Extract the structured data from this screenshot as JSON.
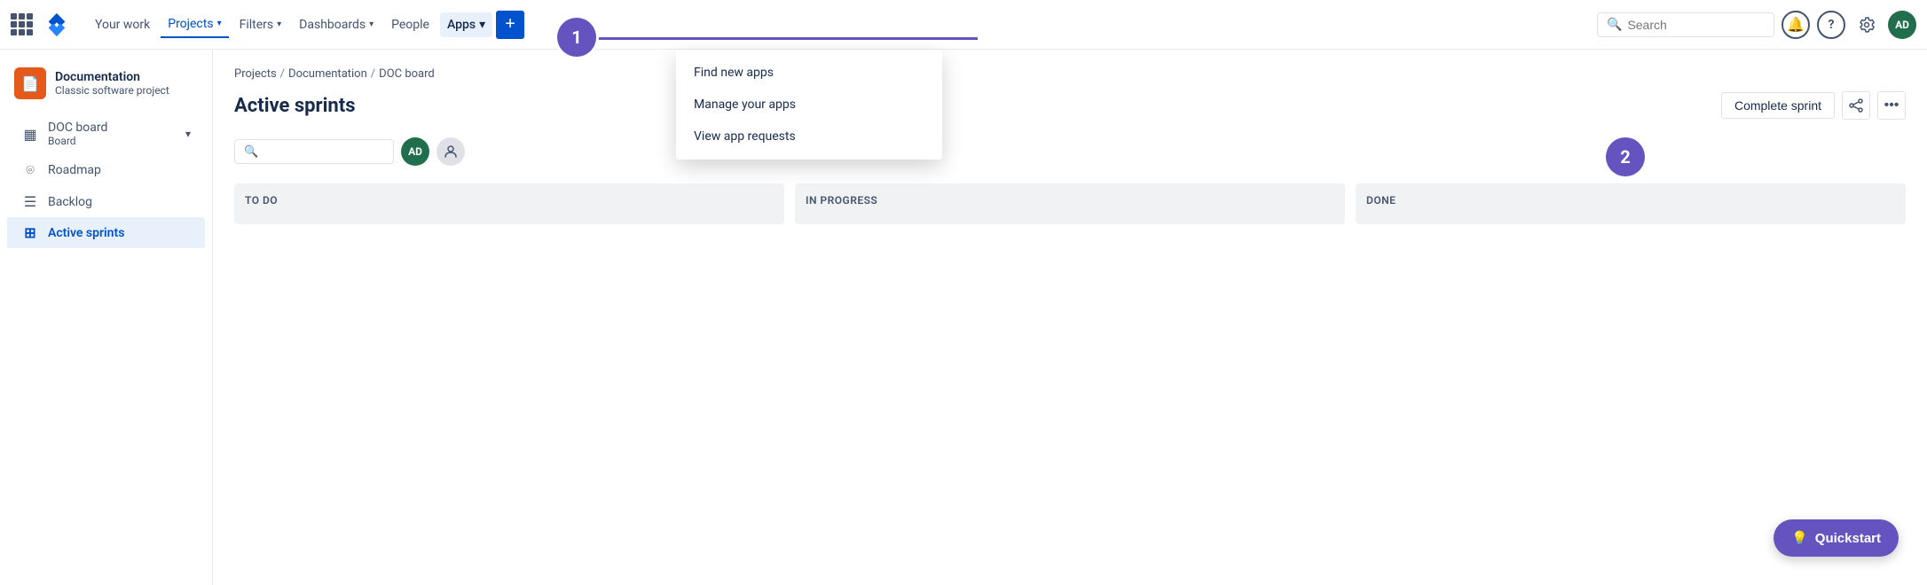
{
  "topnav": {
    "your_work": "Your work",
    "projects": "Projects",
    "filters": "Filters",
    "dashboards": "Dashboards",
    "people": "People",
    "apps": "Apps",
    "search_placeholder": "Search",
    "avatar_initials": "AD",
    "create_label": "+"
  },
  "sidebar": {
    "project_name": "Documentation",
    "project_type": "Classic software project",
    "items": [
      {
        "label": "DOC board",
        "sublabel": "Board",
        "icon": "▦",
        "active": false,
        "has_chevron": true
      },
      {
        "label": "Roadmap",
        "icon": "⌾",
        "active": false
      },
      {
        "label": "Backlog",
        "icon": "☰",
        "active": false
      },
      {
        "label": "Active sprints",
        "icon": "⊞",
        "active": true
      }
    ]
  },
  "breadcrumb": {
    "parts": [
      "Projects",
      "Documentation",
      "DOC board"
    ]
  },
  "page": {
    "title": "Active sprints",
    "complete_sprint": "Complete sprint",
    "share": "⬡",
    "more": "…"
  },
  "board": {
    "columns": [
      {
        "id": "todo",
        "label": "TO DO"
      },
      {
        "id": "inprogress",
        "label": "IN PROGRESS"
      },
      {
        "id": "done",
        "label": "DONE"
      }
    ]
  },
  "dropdown": {
    "items": [
      {
        "label": "Find new apps"
      },
      {
        "label": "Manage your apps"
      },
      {
        "label": "View app requests"
      }
    ]
  },
  "quickstart": {
    "label": "Quickstart"
  },
  "tour": {
    "circle1": "1",
    "circle2": "2"
  },
  "filter_avatar_initials": "AD"
}
